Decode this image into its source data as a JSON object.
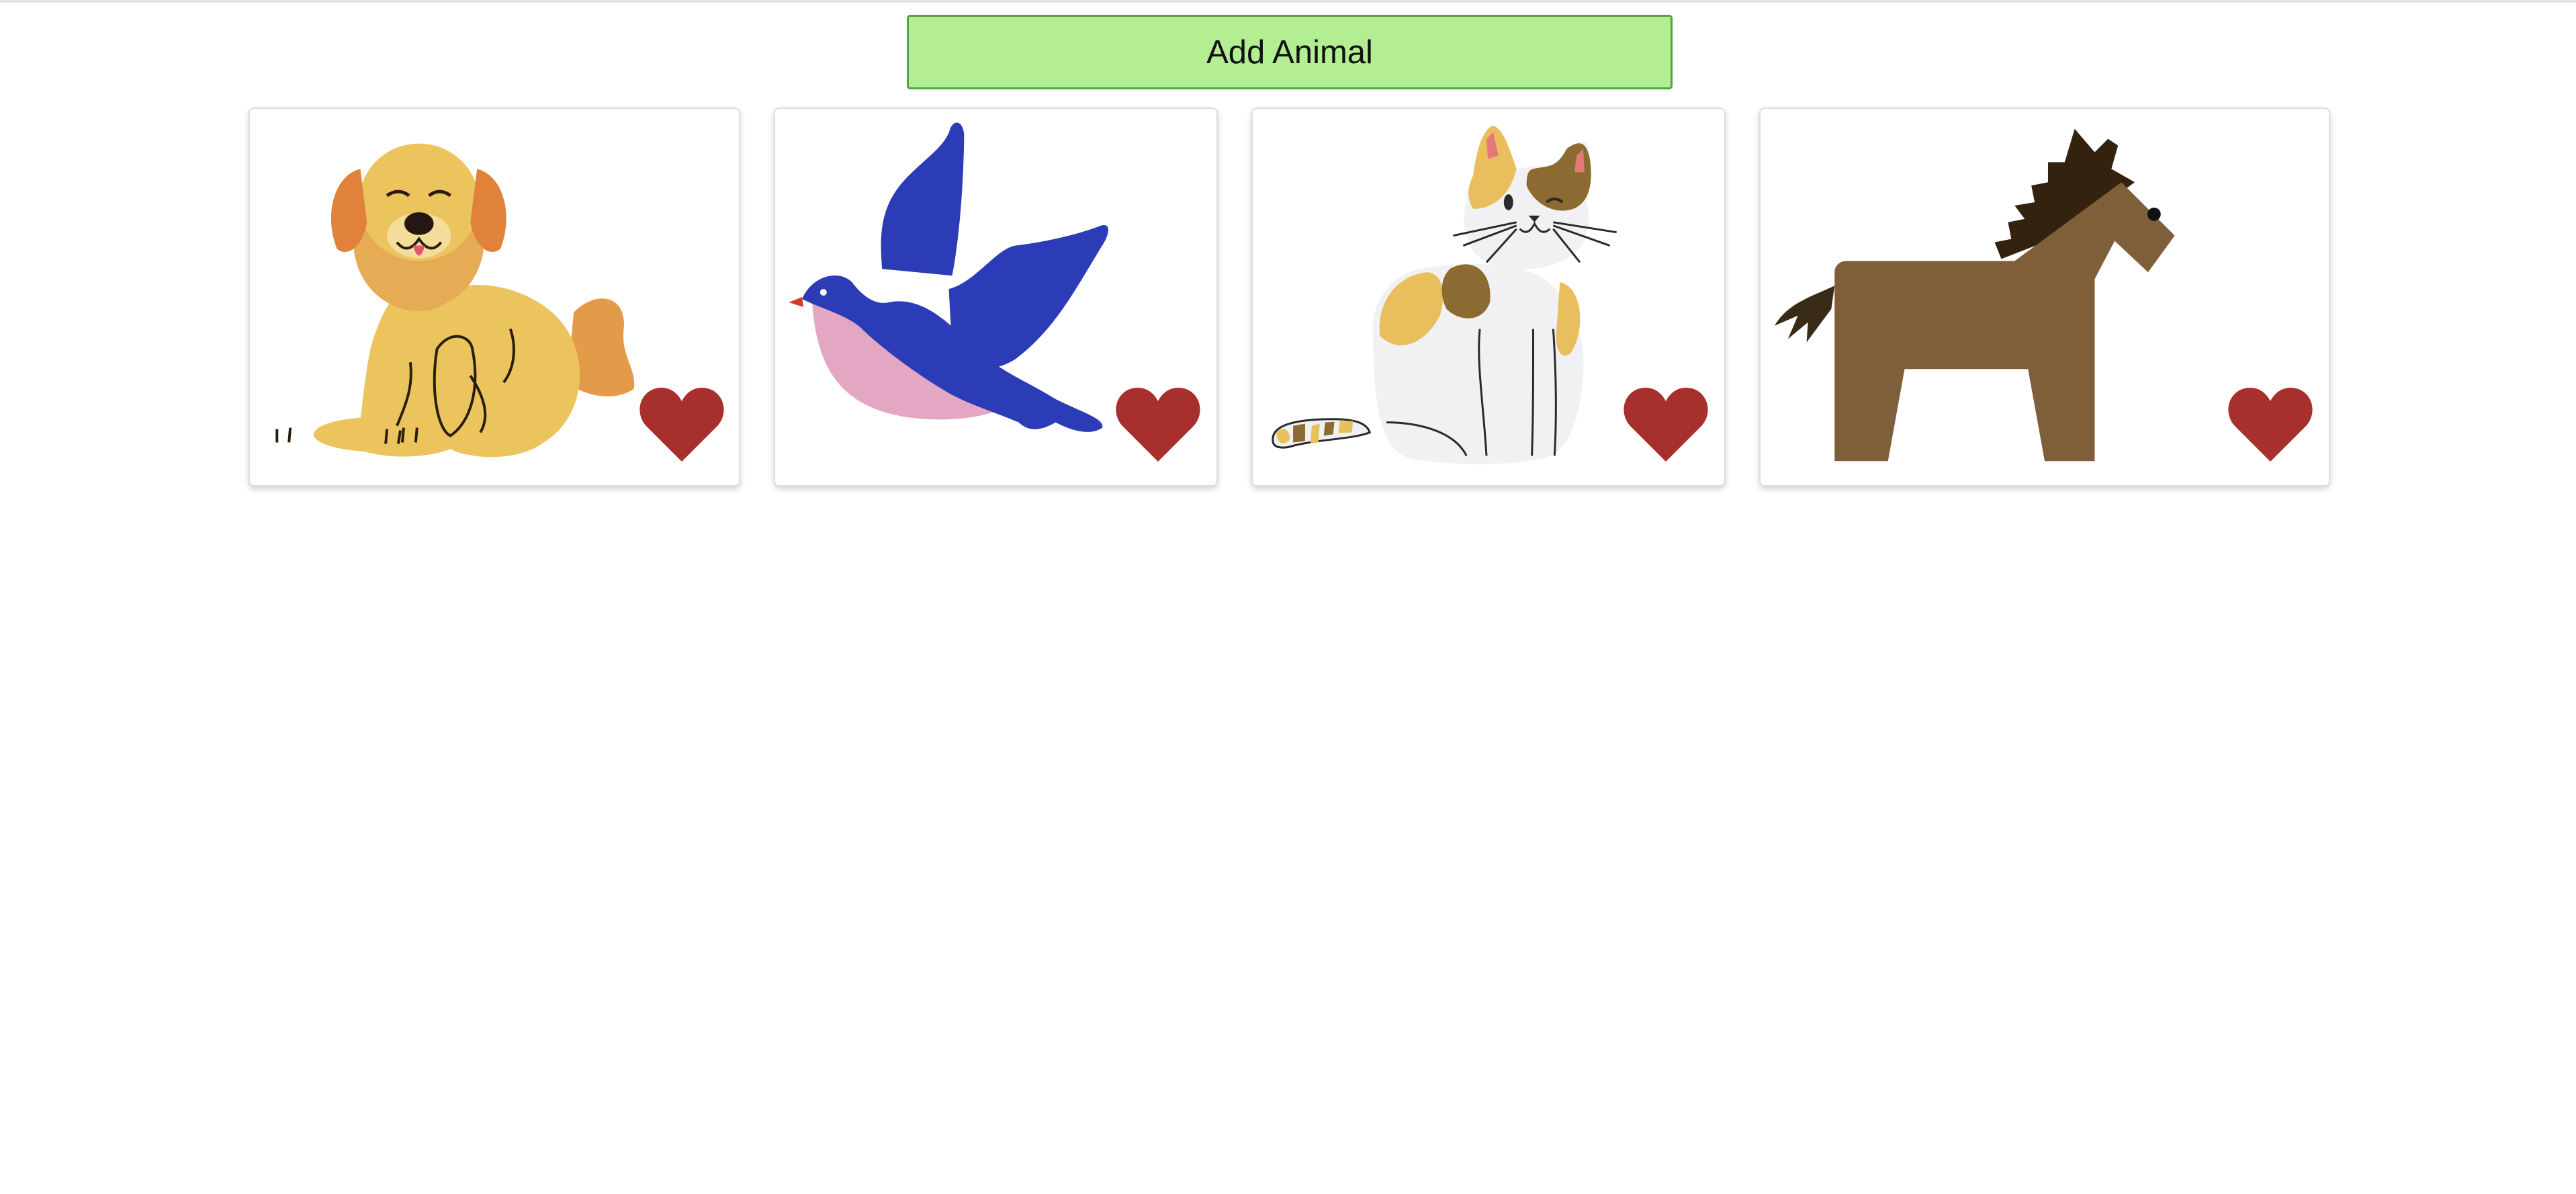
{
  "toolbar": {
    "add_animal_label": "Add Animal"
  },
  "colors": {
    "add_button_bg": "#b4ee93",
    "heart": "#a8302c"
  },
  "animals": [
    {
      "icon": "dog-icon"
    },
    {
      "icon": "bird-icon"
    },
    {
      "icon": "cat-icon"
    },
    {
      "icon": "horse-icon"
    }
  ]
}
